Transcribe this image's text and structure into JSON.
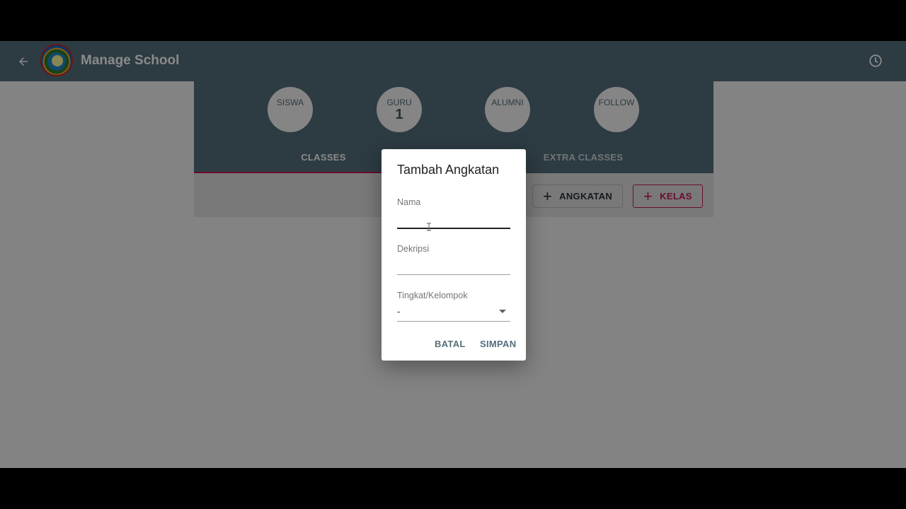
{
  "appbar": {
    "title": "Manage School",
    "back_icon": "arrow-left-icon",
    "history_icon": "clock-icon"
  },
  "stats": [
    {
      "label": "SISWA",
      "value": ""
    },
    {
      "label": "GURU",
      "value": "1"
    },
    {
      "label": "ALUMNI",
      "value": ""
    },
    {
      "label": "FOLLOW",
      "value": ""
    }
  ],
  "tabs": [
    {
      "label": "CLASSES",
      "active": true
    },
    {
      "label": "EXTRA CLASSES",
      "active": false
    }
  ],
  "actions": {
    "angkatan_label": "ANGKATAN",
    "kelas_label": "KELAS"
  },
  "dialog": {
    "title": "Tambah Angkatan",
    "nama_label": "Nama",
    "nama_value": "",
    "deskripsi_label": "Dekripsi",
    "deskripsi_value": "",
    "tingkat_label": "Tingkat/Kelompok",
    "tingkat_value": "-",
    "cancel_label": "BATAL",
    "save_label": "SIMPAN"
  },
  "colors": {
    "primary": "#546e7a",
    "accent": "#c2185b"
  }
}
